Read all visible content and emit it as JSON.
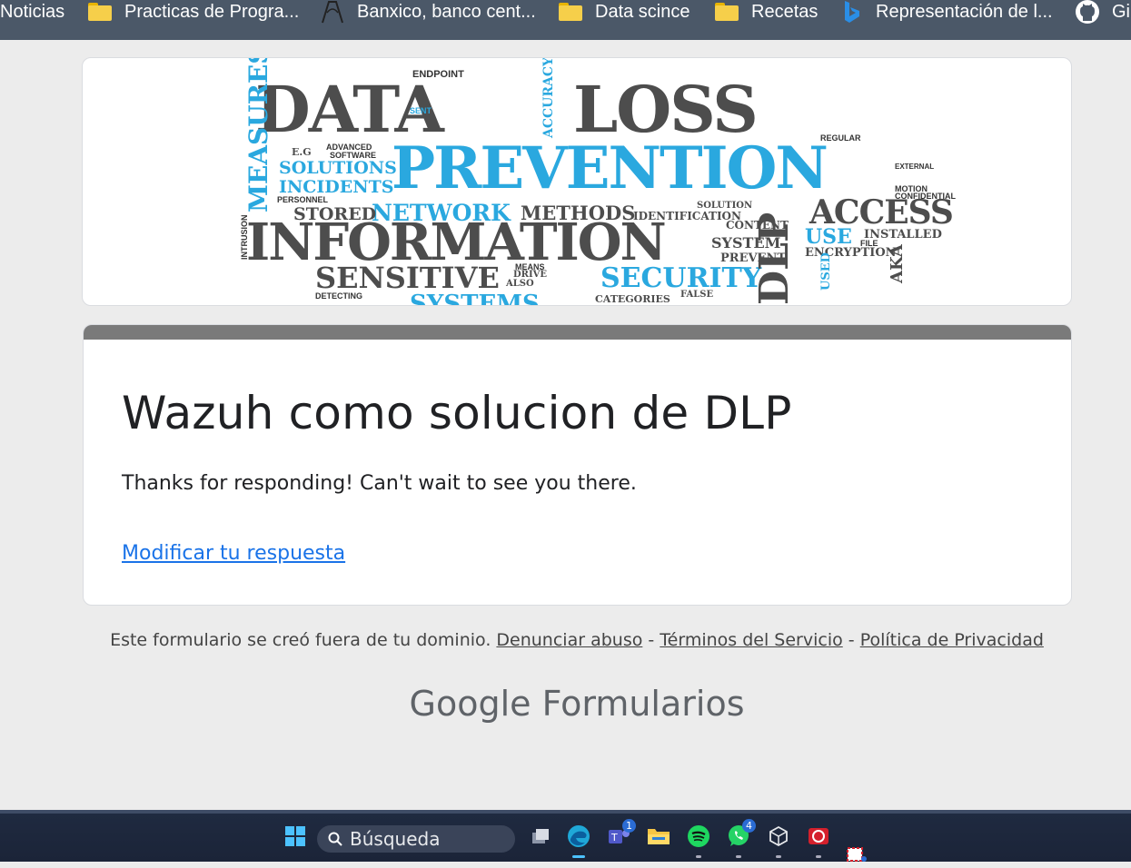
{
  "bookmarks": [
    {
      "label": "Noticias",
      "icon": "none"
    },
    {
      "label": "Practicas de Progra...",
      "icon": "folder-icon"
    },
    {
      "label": "Banxico, banco cent...",
      "icon": "banxico-logo-icon"
    },
    {
      "label": "Data scince",
      "icon": "folder-icon"
    },
    {
      "label": "Recetas",
      "icon": "folder-icon"
    },
    {
      "label": "Representación de l...",
      "icon": "bing-icon"
    },
    {
      "label": "Gi",
      "icon": "github-icon"
    }
  ],
  "banner": {
    "words": {
      "data": "DATA",
      "loss": "LOSS",
      "prevention": "PREVENTION",
      "information": "INFORMATION",
      "sensitive": "SENSITIVE",
      "security": "SECURITY",
      "access": "ACCESS",
      "network": "NETWORK",
      "methods": "METHODS",
      "solutions": "SOLUTIONS",
      "incidents": "INCIDENTS",
      "stored": "STORED",
      "measures": "MEASURES",
      "accuracy": "ACCURACY",
      "endpoint": "ENDPOINT",
      "regular": "REGULAR",
      "use": "USE",
      "system": "SYSTEM",
      "prevent": "PREVENT",
      "encryption": "ENCRYPTION",
      "installed": "INSTALLED",
      "dlp": "DLP",
      "aka": "AKA",
      "content": "CONTENT",
      "identification": "IDENTIFICATION",
      "solution": "SOLUTION",
      "categories": "CATEGORIES",
      "false": "FALSE",
      "detecting": "DETECTING",
      "personnel": "PERSONNEL",
      "eg": "E.G",
      "advanced": "ADVANCED",
      "software": "SOFTWARE",
      "intrusion": "INTRUSION",
      "confidential": "CONFIDENTIAL",
      "motion": "MOTION",
      "external": "EXTERNAL",
      "systems": "SYSTEMS",
      "sent": "SENT",
      "also": "ALSO",
      "means": "MEANS",
      "drive": "DRIVE",
      "used": "USED",
      "file": "FILE"
    }
  },
  "form": {
    "title": "Wazuh como solucion de DLP",
    "message": "Thanks for responding!  Can't wait to see you there.",
    "edit_link": "Modificar tu respuesta"
  },
  "footer": {
    "prefix": "Este formulario se creó fuera de tu dominio.",
    "report_abuse": "Denunciar abuso",
    "separator": "-",
    "terms": "Términos del Servicio",
    "privacy": "Política de Privacidad"
  },
  "brand": {
    "google": "Google",
    "product": "Formularios"
  },
  "taskbar": {
    "search_placeholder": "Búsqueda",
    "teams_badge": "1",
    "whatsapp_badge": "4"
  },
  "colors": {
    "accent_blue": "#1a73e8",
    "bookmark_bar": "#4b5868",
    "page_bg": "#ececec",
    "banner_blue": "#2aa8df"
  }
}
